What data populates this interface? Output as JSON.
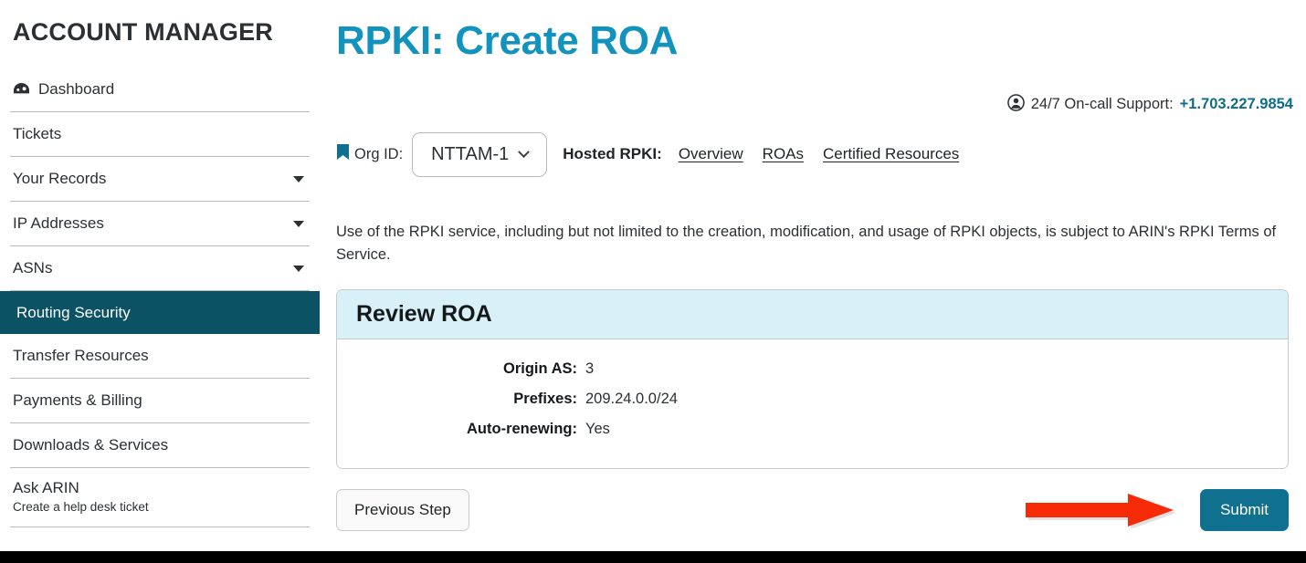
{
  "sidebar": {
    "title": "ACCOUNT MANAGER",
    "items": [
      {
        "label": "Dashboard",
        "icon": "dashboard-icon",
        "caret": false,
        "active": false
      },
      {
        "label": "Tickets",
        "caret": false,
        "active": false
      },
      {
        "label": "Your Records",
        "caret": true,
        "active": false
      },
      {
        "label": "IP Addresses",
        "caret": true,
        "active": false
      },
      {
        "label": "ASNs",
        "caret": true,
        "active": false
      },
      {
        "label": "Routing Security",
        "caret": false,
        "active": true
      },
      {
        "label": "Transfer Resources",
        "caret": false,
        "active": false
      },
      {
        "label": "Payments & Billing",
        "caret": false,
        "active": false
      },
      {
        "label": "Downloads & Services",
        "caret": false,
        "active": false
      }
    ],
    "ask_arin": {
      "title": "Ask ARIN",
      "subtitle": "Create a help desk ticket"
    }
  },
  "header": {
    "page_title": "RPKI: Create ROA",
    "support_icon": "person-circle-icon",
    "support_label": "24/7 On-call Support:",
    "support_phone": "+1.703.227.9854"
  },
  "orgbar": {
    "bookmark_icon": "bookmark-icon",
    "org_id_label": "Org ID:",
    "org_id_value": "NTTAM-1",
    "chevron_icon": "chevron-down-icon",
    "hosted_label": "Hosted RPKI:",
    "links": [
      {
        "label": "Overview"
      },
      {
        "label": "ROAs"
      },
      {
        "label": "Certified Resources"
      }
    ]
  },
  "intro": {
    "text": "Use of the RPKI service, including but not limited to the creation, modification, and usage of RPKI objects, is subject to ARIN's RPKI Terms of Service."
  },
  "panel": {
    "heading": "Review ROA",
    "rows": [
      {
        "key": "Origin AS:",
        "value": "3"
      },
      {
        "key": "Prefixes:",
        "value": "209.24.0.0/24"
      },
      {
        "key": "Auto-renewing:",
        "value": "Yes"
      }
    ]
  },
  "actions": {
    "previous_label": "Previous Step",
    "submit_label": "Submit",
    "annotation_icon": "red-arrow-annotation"
  },
  "colors": {
    "title_blue": "#1193bd",
    "active_nav": "#0b5265",
    "submit_teal": "#10708f",
    "panel_header": "#d8f1f9",
    "link_teal": "#0e6d8c",
    "annotation_red": "#f82b09",
    "footer_black": "#000000"
  }
}
